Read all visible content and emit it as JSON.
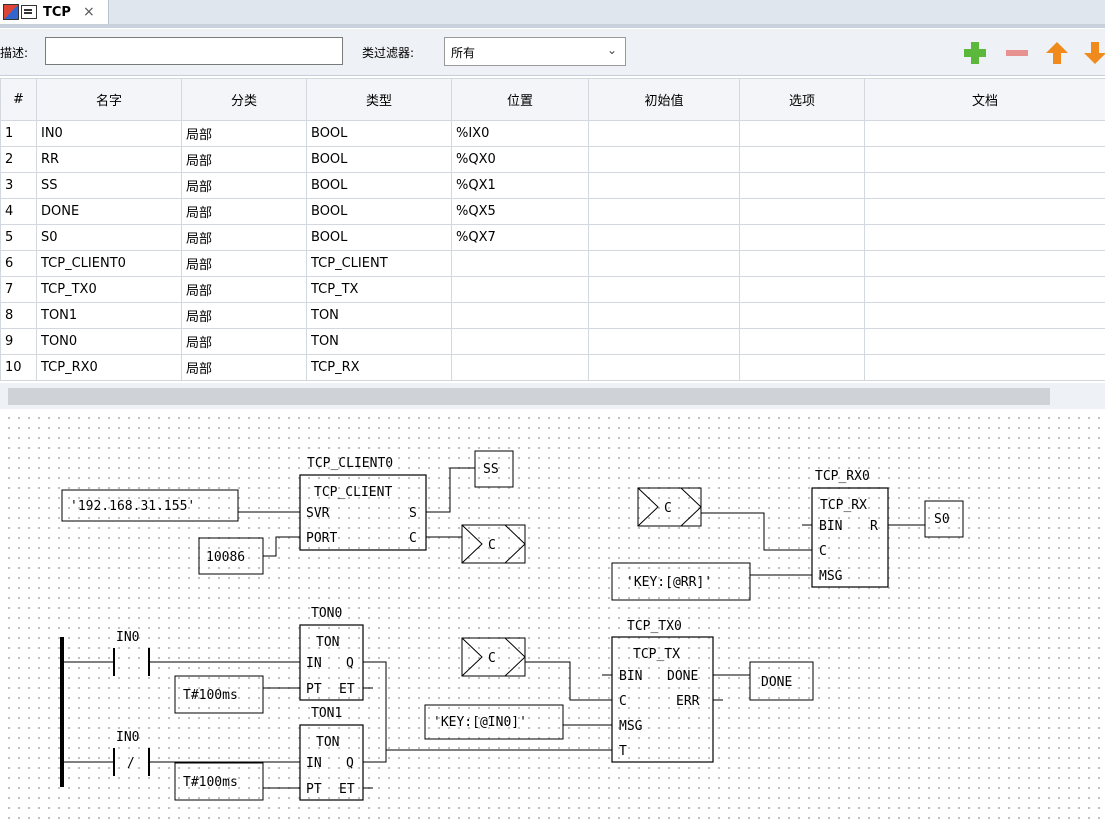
{
  "tab": {
    "title": "TCP",
    "close": "×"
  },
  "toolbar": {
    "desc_label": "描述:",
    "desc_value": "",
    "filter_label": "类过滤器:",
    "filter_value": "所有",
    "colors": {
      "add": "#5cb83a",
      "remove": "#e79191",
      "up": "#f08a1c",
      "down": "#f08a1c"
    }
  },
  "table": {
    "columns": [
      "#",
      "名字",
      "分类",
      "类型",
      "位置",
      "初始值",
      "选项",
      "文档"
    ],
    "rows": [
      {
        "n": "1",
        "name": "IN0",
        "cls": "局部",
        "type": "BOOL",
        "loc": "%IX0",
        "init": "",
        "opt": "",
        "doc": ""
      },
      {
        "n": "2",
        "name": "RR",
        "cls": "局部",
        "type": "BOOL",
        "loc": "%QX0",
        "init": "",
        "opt": "",
        "doc": ""
      },
      {
        "n": "3",
        "name": "SS",
        "cls": "局部",
        "type": "BOOL",
        "loc": "%QX1",
        "init": "",
        "opt": "",
        "doc": ""
      },
      {
        "n": "4",
        "name": "DONE",
        "cls": "局部",
        "type": "BOOL",
        "loc": "%QX5",
        "init": "",
        "opt": "",
        "doc": ""
      },
      {
        "n": "5",
        "name": "S0",
        "cls": "局部",
        "type": "BOOL",
        "loc": "%QX7",
        "init": "",
        "opt": "",
        "doc": ""
      },
      {
        "n": "6",
        "name": "TCP_CLIENT0",
        "cls": "局部",
        "type": "TCP_CLIENT",
        "loc": "",
        "init": "",
        "opt": "",
        "doc": ""
      },
      {
        "n": "7",
        "name": "TCP_TX0",
        "cls": "局部",
        "type": "TCP_TX",
        "loc": "",
        "init": "",
        "opt": "",
        "doc": ""
      },
      {
        "n": "8",
        "name": "TON1",
        "cls": "局部",
        "type": "TON",
        "loc": "",
        "init": "",
        "opt": "",
        "doc": ""
      },
      {
        "n": "9",
        "name": "TON0",
        "cls": "局部",
        "type": "TON",
        "loc": "",
        "init": "",
        "opt": "",
        "doc": ""
      },
      {
        "n": "10",
        "name": "TCP_RX0",
        "cls": "局部",
        "type": "TCP_RX",
        "loc": "",
        "init": "",
        "opt": "",
        "doc": ""
      }
    ]
  },
  "diagram": {
    "client": {
      "inst": "TCP_CLIENT0",
      "type": "TCP_CLIENT",
      "in1": "SVR",
      "in2": "PORT",
      "out1": "S",
      "out2": "C"
    },
    "ip_const": "'192.168.31.155'",
    "port_const": "10086",
    "ss_var": "SS",
    "c_out": "C",
    "rx": {
      "inst": "TCP_RX0",
      "type": "TCP_RX",
      "in1": "BIN",
      "in2": "C",
      "in3": "MSG",
      "out1": "R"
    },
    "rx_c_in": "C",
    "rx_msg": "'KEY:[@RR]'",
    "s0_var": "S0",
    "ton0": {
      "inst": "TON0",
      "type": "TON",
      "in1": "IN",
      "in2": "PT",
      "out1": "Q",
      "out2": "ET"
    },
    "ton1": {
      "inst": "TON1",
      "type": "TON",
      "in1": "IN",
      "in2": "PT",
      "out1": "Q",
      "out2": "ET"
    },
    "contact1": "IN0",
    "contact2": "IN0",
    "contact2_sym": "/",
    "t1": "T#100ms",
    "t2": "T#100ms",
    "tx": {
      "inst": "TCP_TX0",
      "type": "TCP_TX",
      "in1": "BIN",
      "in2": "C",
      "in3": "MSG",
      "in4": "T",
      "out1": "DONE",
      "out2": "ERR"
    },
    "tx_c_in": "C",
    "tx_msg": "'KEY:[@IN0]'",
    "done_var": "DONE"
  }
}
